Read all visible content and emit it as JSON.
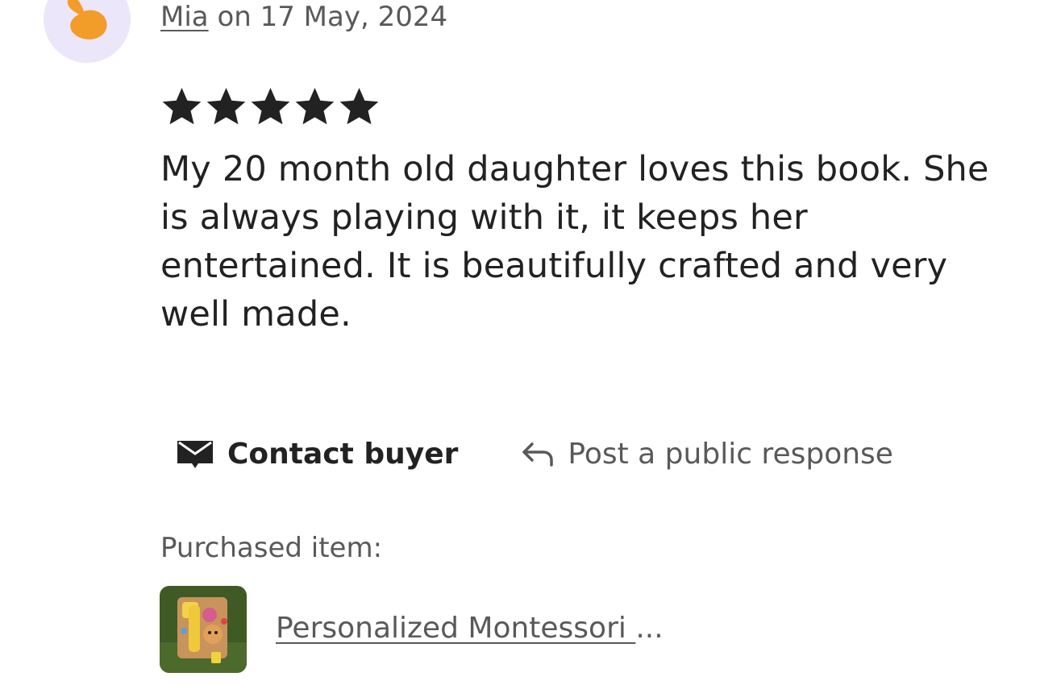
{
  "review": {
    "author": "Mia",
    "date_text": "on 17 May, 2024",
    "rating": 5,
    "rating_max": 5,
    "text": "My 20 month old daughter loves this book. She is always playing with it, it keeps her entertained. It is beautifully crafted and very well made.",
    "avatar_bg": "#ece6fb",
    "avatar_fg": "#f29d2a"
  },
  "actions": {
    "contact": {
      "label": "Contact buyer",
      "icon": "envelope-icon"
    },
    "respond": {
      "label": "Post a public response",
      "icon": "reply-arrow-icon"
    }
  },
  "purchased": {
    "label": "Purchased item:",
    "item_name": "Personalized Montessori ",
    "ellipsis": "..."
  },
  "colors": {
    "text_primary": "#222222",
    "text_secondary": "#595959",
    "background": "#ffffff"
  }
}
